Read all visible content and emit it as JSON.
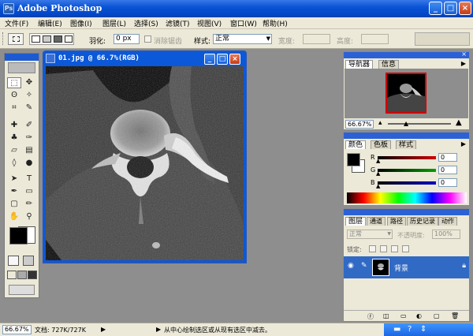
{
  "window": {
    "title": "Adobe Photoshop",
    "app_icon": "Ps"
  },
  "caption_buttons": {
    "minimize": "_",
    "maximize": "□",
    "close": "×"
  },
  "menu": [
    "文件(F)",
    "编辑(E)",
    "图像(I)",
    "图层(L)",
    "选择(S)",
    "滤镜(T)",
    "视图(V)",
    "窗口(W)",
    "帮助(H)"
  ],
  "options": {
    "feather_label": "羽化:",
    "feather_value": "0 px",
    "antialias_label": "消除锯齿",
    "style_label": "样式:",
    "style_value": "正常",
    "width_label": "宽度:",
    "height_label": "高度:"
  },
  "document": {
    "title": "01.jpg @ 66.7%(RGB)"
  },
  "navigator": {
    "tabs": [
      "导航器",
      "信息"
    ],
    "zoom": "66.67%"
  },
  "color": {
    "tabs": [
      "颜色",
      "色板",
      "样式"
    ],
    "channels": [
      {
        "label": "R",
        "value": "0",
        "color": "#d00000"
      },
      {
        "label": "G",
        "value": "0",
        "color": "#00a000"
      },
      {
        "label": "B",
        "value": "0",
        "color": "#0000c8"
      }
    ]
  },
  "layers": {
    "tabs": [
      "图层",
      "通道",
      "路径",
      "历史记录",
      "动作"
    ],
    "blend_mode": "正常",
    "opacity_label": "不透明度:",
    "opacity_value": "100%",
    "lock_label": "锁定:",
    "layer_name": "背景"
  },
  "status": {
    "zoom": "66.67%",
    "doc_size": "文档: 727K/727K",
    "hint": "从中心绘制选区或从现有选区中减去。"
  },
  "colors": {
    "title_bar": "#0a54d6",
    "chrome": "#ece9d8",
    "workspace": "#8e8e8e",
    "selected_layer": "#316ac5"
  }
}
